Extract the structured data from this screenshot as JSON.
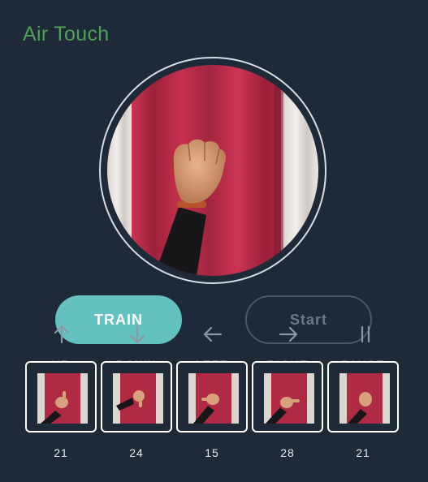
{
  "app": {
    "title": "Air Touch"
  },
  "camera": {
    "label": "webcam-preview"
  },
  "buttons": {
    "train": "TRAIN",
    "start": "Start"
  },
  "gestures": [
    {
      "label": "UP",
      "count": "21",
      "icon": "arrow-up-icon"
    },
    {
      "label": "DOWN",
      "count": "24",
      "icon": "arrow-down-icon"
    },
    {
      "label": "LEFT",
      "count": "15",
      "icon": "arrow-left-icon"
    },
    {
      "label": "RIGHT",
      "count": "28",
      "icon": "arrow-right-icon"
    },
    {
      "label": "PAUSE",
      "count": "21",
      "icon": "pause-icon"
    }
  ],
  "colors": {
    "background": "#1f2a38",
    "title": "#4fa05a",
    "train_button": "#63c1c0",
    "curtain": "#b02a44"
  }
}
